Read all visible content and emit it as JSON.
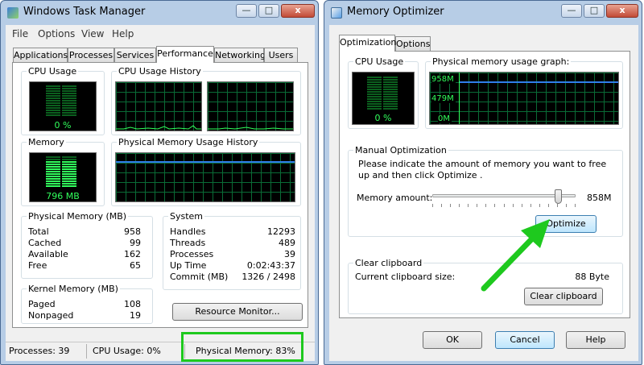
{
  "task_manager": {
    "title": "Windows Task Manager",
    "controls": {
      "minimize": "—",
      "maximize": "□",
      "close": "x"
    },
    "menu": [
      "File",
      "Options",
      "View",
      "Help"
    ],
    "tabs": [
      "Applications",
      "Processes",
      "Services",
      "Performance",
      "Networking",
      "Users"
    ],
    "active_tab": "Performance",
    "cpu_usage": {
      "label": "CPU Usage",
      "value": "0 %",
      "level": 0.0
    },
    "cpu_history": {
      "label": "CPU Usage History"
    },
    "memory": {
      "label": "Memory",
      "value": "796 MB",
      "level": 0.83
    },
    "memory_history": {
      "label": "Physical Memory Usage History",
      "level": 0.83
    },
    "physical_memory": {
      "label": "Physical Memory (MB)",
      "rows": [
        {
          "name": "Total",
          "value": "958"
        },
        {
          "name": "Cached",
          "value": "99"
        },
        {
          "name": "Available",
          "value": "162"
        },
        {
          "name": "Free",
          "value": "65"
        }
      ]
    },
    "system": {
      "label": "System",
      "rows": [
        {
          "name": "Handles",
          "value": "12293"
        },
        {
          "name": "Threads",
          "value": "489"
        },
        {
          "name": "Processes",
          "value": "39"
        },
        {
          "name": "Up Time",
          "value": "0:02:43:37"
        },
        {
          "name": "Commit (MB)",
          "value": "1326 / 2498"
        }
      ]
    },
    "kernel_memory": {
      "label": "Kernel Memory (MB)",
      "rows": [
        {
          "name": "Paged",
          "value": "108"
        },
        {
          "name": "Nonpaged",
          "value": "19"
        }
      ]
    },
    "resource_monitor_button": "Resource Monitor...",
    "status": {
      "processes": "Processes: 39",
      "cpu": "CPU Usage: 0%",
      "memory": "Physical Memory: 83%"
    }
  },
  "memory_optimizer": {
    "title": "Memory Optimizer",
    "controls": {
      "minimize": "—",
      "maximize": "□",
      "close": "x"
    },
    "tabs": [
      "Optimization",
      "Options"
    ],
    "active_tab": "Optimization",
    "cpu_usage": {
      "label": "CPU Usage",
      "value": "0 %",
      "level": 0.0
    },
    "graph": {
      "label": "Physical memory usage graph:",
      "axis": [
        "958M",
        "479M",
        "0M"
      ],
      "level": 0.83
    },
    "manual": {
      "label": "Manual Optimization",
      "instruction": "Please indicate the amount of memory you want to free up and then click Optimize .",
      "amount_label": "Memory amount:",
      "amount_value": "858M",
      "slider_level": 0.9,
      "optimize_button": "Optimize"
    },
    "clipboard": {
      "label": "Clear clipboard",
      "size_label": "Current clipboard size:",
      "size_value": "88 Byte",
      "clear_button": "Clear clipboard"
    },
    "footer": {
      "ok": "OK",
      "cancel": "Cancel",
      "help": "Help"
    }
  },
  "colors": {
    "highlight": "#1ec91e",
    "meter_on": "#31ff5c",
    "graph_line": "#2f7eea"
  }
}
